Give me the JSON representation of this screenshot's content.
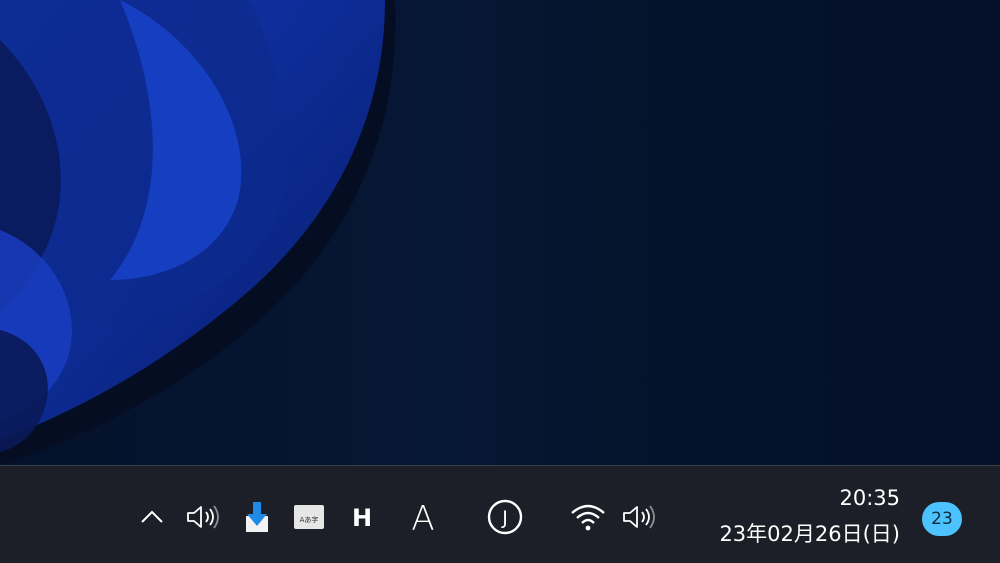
{
  "taskbar": {
    "tray_icons": [
      {
        "name": "chevron-up-icon"
      },
      {
        "name": "speaker-icon"
      },
      {
        "name": "download-icon"
      },
      {
        "name": "ime-keyboard-icon",
        "label": "Aあ字"
      },
      {
        "name": "h-app-icon",
        "label": "H"
      },
      {
        "name": "ime-mode-icon",
        "label": "A"
      },
      {
        "name": "circle-j-icon",
        "label": "J"
      },
      {
        "name": "wifi-icon"
      },
      {
        "name": "volume-icon"
      }
    ],
    "clock": {
      "time": "20:35",
      "date": "23年02月26日(日)"
    },
    "notifications": {
      "count": "23",
      "badge_color": "#4cc2ff"
    }
  },
  "colors": {
    "taskbar_bg": "#1c1f27",
    "wallpaper_bg": "#04122b",
    "accent": "#4cc2ff"
  }
}
